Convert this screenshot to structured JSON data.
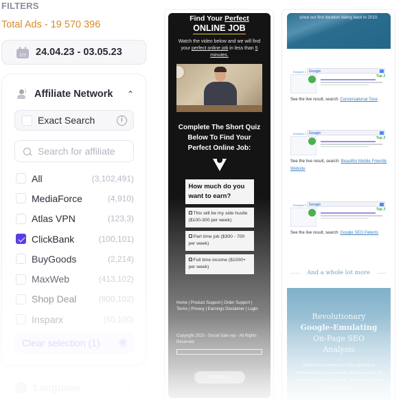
{
  "filters": {
    "heading": "FILTERS",
    "total_ads": "Total Ads - 19 570 396",
    "date_range": "24.04.23 - 03.05.23"
  },
  "affiliate_network": {
    "title": "Affiliate Network",
    "exact_search_label": "Exact Search",
    "exact_search_checked": false,
    "search_placeholder": "Search for affiliate",
    "items": [
      {
        "name": "All",
        "count": "(3,102,491)",
        "checked": false
      },
      {
        "name": "MediaForce",
        "count": "(4,910)",
        "checked": false
      },
      {
        "name": "Atlas VPN",
        "count": "(123,3)",
        "checked": false
      },
      {
        "name": "ClickBank",
        "count": "(100,101)",
        "checked": true
      },
      {
        "name": "BuyGoods",
        "count": "(2,214)",
        "checked": false
      },
      {
        "name": "MaxWeb",
        "count": "(413,102)",
        "checked": false
      },
      {
        "name": "Shop Deal",
        "count": "(800,102)",
        "checked": false
      },
      {
        "name": "Insparx",
        "count": "(50,100)",
        "checked": false
      }
    ],
    "clear_selection": "Clear selection (1)"
  },
  "language": {
    "title": "Language"
  },
  "ads": [
    {
      "headline_part1": "Find Your ",
      "headline_underlined": "Perfect",
      "headline_big": "ONLINE JOB",
      "sub_part1": "Watch the video below and we will find your ",
      "sub_link": "perfect online job",
      "sub_part2": " in less than ",
      "sub_link2": "5 minutes.",
      "quiz_title": "Complete The Short Quiz Below To Find Your Perfect Online Job:",
      "question": "How much do you want to earn?",
      "options": [
        "This will be my side hustle ($100-300 per week)",
        "Part time job ($300 - 700 per week)",
        "Full time income ($1000+ per week)"
      ],
      "footer_links": "Home | Product Support | Order Support | Terms | Privacy | Earnings Disclaimer | Login",
      "copyright": "Copyright 2023 - Social Sale rep - All Rights Reserved",
      "contact_button": "Contact Us"
    },
    {
      "hero_top_text": "since our first iteration dating back to 2010.",
      "examples": [
        {
          "label": "Example 1",
          "caption": "See the live result, search: ",
          "link": "Conversational Tone",
          "badge": "Top 3"
        },
        {
          "label": "Example 2",
          "caption": "See the live result, search: ",
          "link": "Beautiful Mobile Friendly Website",
          "badge": "Top 3"
        },
        {
          "label": "Example 3",
          "caption": "See the live result, search: ",
          "link": "Google SEO Patents",
          "badge": "Top 3"
        }
      ],
      "more_text": "And a whole lot more",
      "hero_line1": "Revolutionary",
      "hero_line2": "Google-Emulating",
      "hero_line3": "On-Page SEO",
      "hero_line4": "Analysis",
      "hero_paragraph": "SEOPressor's brand new 2016 algorithm is formulated based on semantic big data analysis of more than 3 billion rows of data. We are here to push you to the top of"
    }
  ],
  "colors": {
    "accent": "#5b3ee0",
    "total_ads": "#d98a2b"
  }
}
